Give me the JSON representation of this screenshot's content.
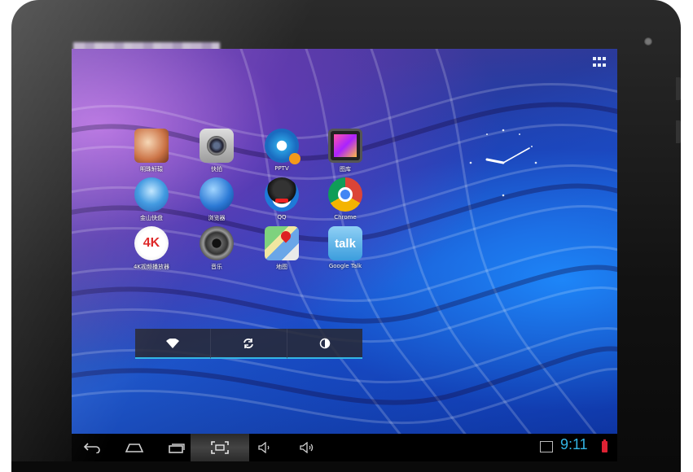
{
  "apps": [
    {
      "label": "明珠轩辕",
      "icon": "game-hero-icon"
    },
    {
      "label": "快拍",
      "icon": "camera-icon"
    },
    {
      "label": "PPTV",
      "icon": "pptv-icon"
    },
    {
      "label": "图库",
      "icon": "gallery-icon"
    },
    {
      "label": "金山快盘",
      "icon": "kuaipan-icon"
    },
    {
      "label": "浏览器",
      "icon": "browser-globe-icon"
    },
    {
      "label": "QQ",
      "icon": "qq-penguin-icon"
    },
    {
      "label": "Chrome",
      "icon": "chrome-icon"
    },
    {
      "label": "4K视频播放器",
      "icon": "4k-player-icon"
    },
    {
      "label": "音乐",
      "icon": "music-speaker-icon"
    },
    {
      "label": "地图",
      "icon": "maps-icon"
    },
    {
      "label": "Google Talk",
      "icon": "talk-icon"
    }
  ],
  "talk_icon_text": "talk",
  "fourk_icon_text": "4K",
  "status": {
    "time": "9:11"
  },
  "colors": {
    "accent": "#33b5e5",
    "battery": "#dd2233"
  }
}
